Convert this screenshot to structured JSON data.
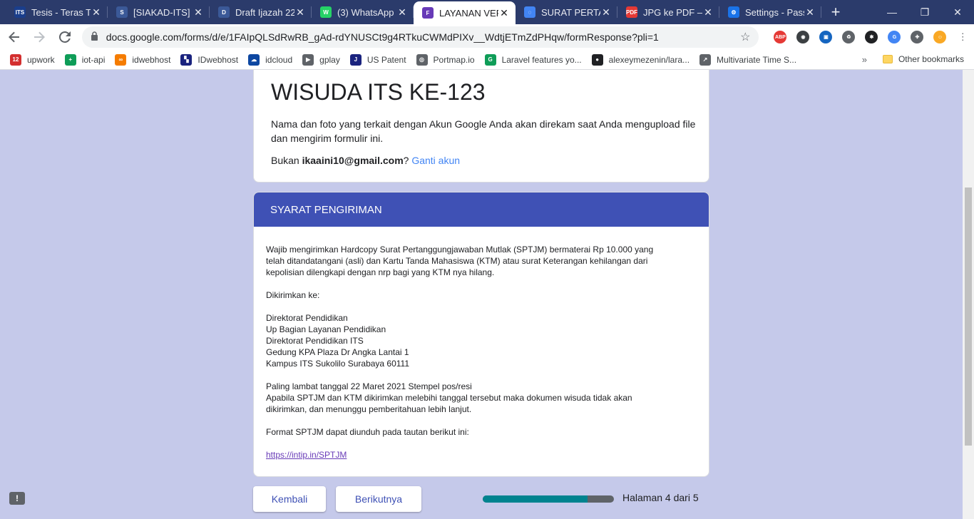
{
  "tabs": [
    {
      "title": "Tesis - Teras Te",
      "favicon": "ITS",
      "color": "#1a3e8c",
      "active": false
    },
    {
      "title": "[SIAKAD-ITS] E",
      "favicon": "S",
      "color": "#3b5998",
      "active": false
    },
    {
      "title": "Draft Ijazah 22",
      "favicon": "D",
      "color": "#3b5998",
      "active": false
    },
    {
      "title": "(3) WhatsApp",
      "favicon": "W",
      "color": "#25d366",
      "active": false
    },
    {
      "title": "LAYANAN VER",
      "favicon": "F",
      "color": "#673ab7",
      "active": true
    },
    {
      "title": "SURAT PERTAN",
      "favicon": "◌",
      "color": "#4285f4",
      "active": false
    },
    {
      "title": "JPG ke PDF – I",
      "favicon": "PDF",
      "color": "#e53935",
      "active": false
    },
    {
      "title": "Settings - Pass",
      "favicon": "⚙",
      "color": "#1a73e8",
      "active": false
    }
  ],
  "new_tab_label": "+",
  "window_controls": {
    "minimize": "—",
    "restore": "❐",
    "close": "✕"
  },
  "url": "docs.google.com/forms/d/e/1FAIpQLSdRwRB_gAd-rdYNUSCt9g4RTkuCWMdPIXv__WdtjETmZdPHqw/formResponse?pli=1",
  "extensions": [
    {
      "name": "adblock-icon",
      "label": "ABP",
      "color": "#e53935"
    },
    {
      "name": "extension-2-icon",
      "label": "◉",
      "color": "#3c4043"
    },
    {
      "name": "extension-3-icon",
      "label": "▣",
      "color": "#1565c0"
    },
    {
      "name": "recycle-icon",
      "label": "♻",
      "color": "#5f6368"
    },
    {
      "name": "extension-5-icon",
      "label": "✱",
      "color": "#202124"
    },
    {
      "name": "translate-icon",
      "label": "G",
      "color": "#4285f4"
    },
    {
      "name": "puzzle-icon",
      "label": "✚",
      "color": "#5f6368"
    },
    {
      "name": "profile-avatar-icon",
      "label": "☺",
      "color": "#f9a825"
    }
  ],
  "bookmarks": [
    {
      "label": "upwork",
      "icon": "12",
      "color": "#d32f2f"
    },
    {
      "label": "iot-api",
      "icon": "+",
      "color": "#0f9d58"
    },
    {
      "label": "idwebhost",
      "icon": "∞",
      "color": "#f57c00"
    },
    {
      "label": "IDwebhost",
      "icon": "▚",
      "color": "#1a237e"
    },
    {
      "label": "idcloud",
      "icon": "☁",
      "color": "#0d47a1"
    },
    {
      "label": "gplay",
      "icon": "▶",
      "color": "#5f6368"
    },
    {
      "label": "US Patent",
      "icon": "J",
      "color": "#1a237e"
    },
    {
      "label": "Portmap.io",
      "icon": "◎",
      "color": "#5f6368"
    },
    {
      "label": "Laravel features yo...",
      "icon": "G",
      "color": "#0f9d58"
    },
    {
      "label": "alexeymezenin/lara...",
      "icon": "●",
      "color": "#202124"
    },
    {
      "label": "Multivariate Time S...",
      "icon": "↗",
      "color": "#5f6368"
    }
  ],
  "bookmarks_more": "»",
  "other_bookmarks": "Other bookmarks",
  "form": {
    "title": "WISUDA ITS KE-123",
    "note": "Nama dan foto yang terkait dengan Akun Google Anda akan direkam saat Anda mengupload file dan mengirim formulir ini.",
    "account_prefix": "Bukan ",
    "account_email": "ikaaini10@gmail.com",
    "account_q": "?",
    "switch_account": "Ganti akun",
    "section_title": "SYARAT PENGIRIMAN",
    "paragraphs": [
      [
        "Wajib mengirimkan Hardcopy Surat Pertanggungjawaban Mutlak (SPTJM) bermaterai Rp 10.000 yang",
        "telah ditandatangani (asli) dan Kartu Tanda Mahasiswa (KTM) atau surat Keterangan kehilangan dari",
        "kepolisian dilengkapi dengan nrp bagi yang KTM nya hilang."
      ],
      [
        "Dikirimkan ke:"
      ],
      [
        "Direktorat Pendidikan",
        "Up Bagian Layanan Pendidikan",
        "Direktorat Pendidikan ITS",
        "Gedung KPA Plaza Dr Angka Lantai 1",
        "Kampus ITS Sukolilo Surabaya 60111"
      ],
      [
        "Paling lambat tanggal 22 Maret 2021 Stempel pos/resi",
        "Apabila SPTJM dan KTM dikirimkan melebihi tanggal tersebut maka dokumen wisuda tidak akan",
        "dikirimkan, dan menunggu pemberitahuan lebih lanjut."
      ],
      [
        "Format SPTJM dapat diunduh pada tautan berikut ini:"
      ]
    ],
    "link": "https://intip.in/SPTJM",
    "back_button": "Kembali",
    "next_button": "Berikutnya",
    "progress_fraction": 0.8,
    "page_indicator": "Halaman 4 dari 5"
  },
  "feedback_icon_label": "!"
}
